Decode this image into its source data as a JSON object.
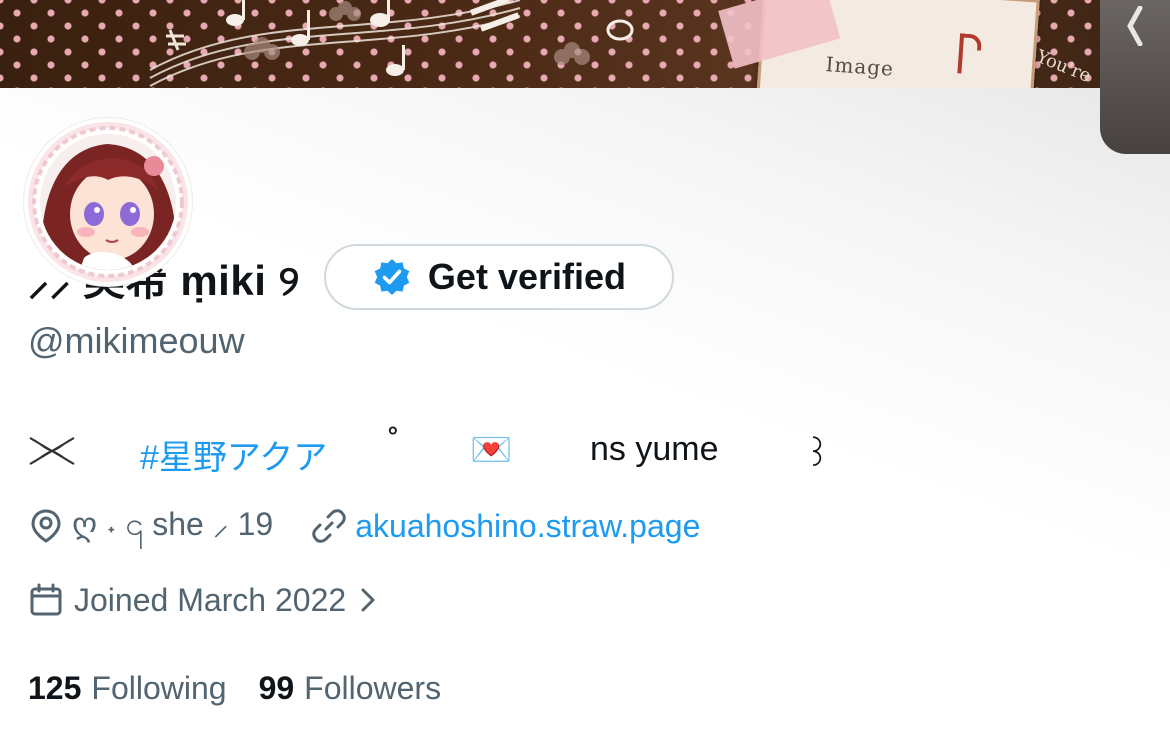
{
  "banner": {
    "card_text": "Image",
    "script_text": "You're"
  },
  "profile": {
    "display_name": "⸝⸝ 美希 ṃiki ୨",
    "verify_label": "Get verified",
    "handle": "@mikimeouw",
    "bio": {
      "hashtag": "#星野アクア",
      "degree": "˚",
      "letter_emoji": "💌",
      "text": "ns yume",
      "tail": "꒱"
    },
    "location": "ღ ˖ ၎ she ⸝ 19",
    "website": "akuahoshino.straw.page",
    "joined": "Joined March 2022",
    "following_count": "125",
    "following_label": "Following",
    "followers_count": "99",
    "followers_label": "Followers"
  },
  "colors": {
    "link": "#1d9bf0",
    "text_primary": "#0f1419",
    "text_secondary": "#536471",
    "button_border": "#cfd9de"
  },
  "icons": {
    "verified": "verified-badge-icon",
    "bio_decoration": "crossed-ribbon-icon",
    "location": "location-pin-icon",
    "link": "link-chain-icon",
    "calendar": "calendar-icon",
    "chevron": "chevron-right-icon"
  }
}
